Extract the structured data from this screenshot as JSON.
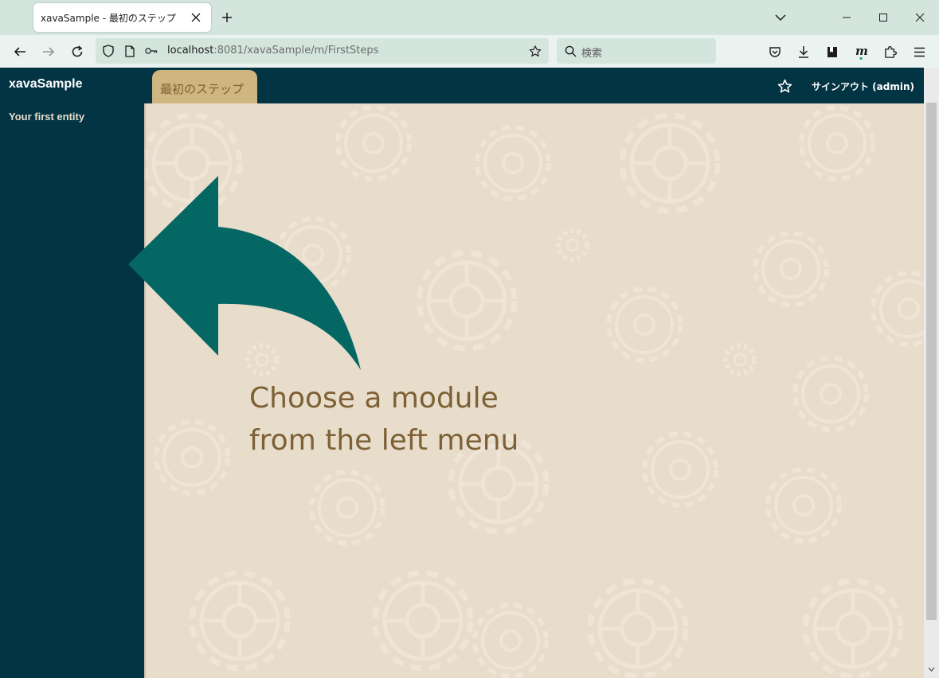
{
  "browser": {
    "tab_title": "xavaSample - 最初のステップ",
    "url_host": "localhost",
    "url_rest": ":8081/xavaSample/m/FirstSteps",
    "search_placeholder": "検索"
  },
  "app": {
    "name": "xavaSample",
    "menu_items": [
      {
        "label": "Your first entity"
      }
    ]
  },
  "header": {
    "module_tab": "最初のステップ",
    "signout_label": "サインアウト (admin)"
  },
  "main": {
    "prompt_line1": "Choose a module",
    "prompt_line2": "from the left menu"
  },
  "colors": {
    "sidebar_bg": "#023444",
    "content_bg": "#e8dccb",
    "tab_accent": "#cfb57f",
    "arrow": "#046764",
    "prompt_text": "#7d6135"
  }
}
